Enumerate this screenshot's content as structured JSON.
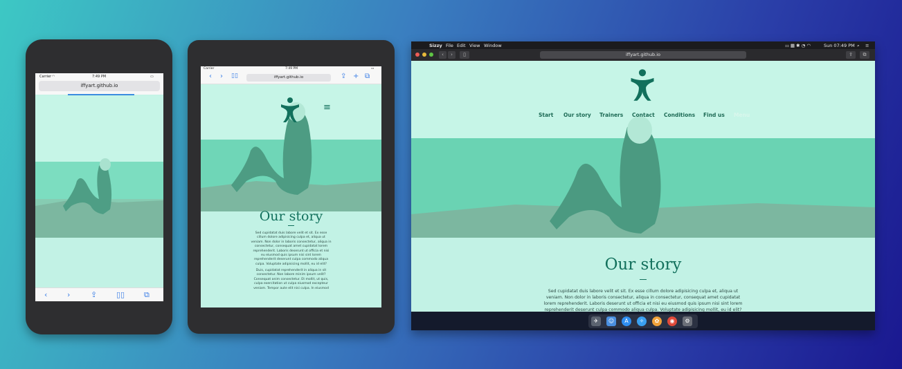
{
  "phone": {
    "status": {
      "carrier": "Carrier",
      "time": "7:49 PM"
    },
    "url": "iffyart.github.io",
    "dash": "—",
    "toolbar": {
      "back": "‹",
      "forward": "›",
      "share": "⇪",
      "bookmarks": "▯▯",
      "tabs": "⧉"
    }
  },
  "tablet": {
    "status": {
      "carrier": "Carrier",
      "time": "7:49 PM"
    },
    "url": "iffyart.github.io",
    "story_title": "Our story",
    "paragraph1": "Sed cupidatat duis labore velit et sit. Ex esse cillum dolore adipisicing culpa et, aliqua ut veniam. Non dolor in laboris consectetur, aliqua in consectetur, consequat amet cupidatat lorem reprehenderit. Laboris deserunt ut officia et nisi eu eiusmod quis ipsum nisi sint lorem reprehenderit deserunt culpa commodo aliqua culpa. Voluptate adipisicing mollit, eu id elit?",
    "paragraph2": "Duis, cupidatat reprehenderit in aliqua in sit consectetur. Non labore minim ipsum velit? Consequat anim consectetur. Et mollit, ut quis, culpa exercitation ut culpa eiusmod excepteur veniam. Tempor aute elit nisi culpa. In eiusmod"
  },
  "desktop": {
    "menubar": {
      "app": "Sizzy",
      "file": "File",
      "edit": "Edit",
      "view": "View",
      "window": "Window",
      "clock": "Sun 07:49 PM"
    },
    "url": "iffyart.github.io",
    "nav": [
      "Start",
      "Our story",
      "Trainers",
      "Contact",
      "Conditions",
      "Find us",
      "Menu"
    ],
    "story_title": "Our story",
    "paragraph": "Sed cupidatat duis labore velit et sit. Ex esse cillum dolore adipisicing culpa et, aliqua ut veniam. Non dolor in laboris consectetur, aliqua in consectetur, consequat amet cupidatat lorem reprehenderit. Laboris deserunt ut officia et nisi eu eiusmod quis ipsum nisi sint lorem reprehenderit deserunt culpa commodo aliqua culpa. Voluptate adipisicing mollit, eu id elit?",
    "dock": [
      "launchpad-icon",
      "finder-icon",
      "app-store-icon",
      "safari-icon",
      "photos-icon",
      "chrome-icon",
      "system-preferences-icon"
    ]
  },
  "colors": {
    "mint": "#c2f2e5",
    "teal_dark": "#12705c",
    "link_blue": "#3a7ee6"
  }
}
